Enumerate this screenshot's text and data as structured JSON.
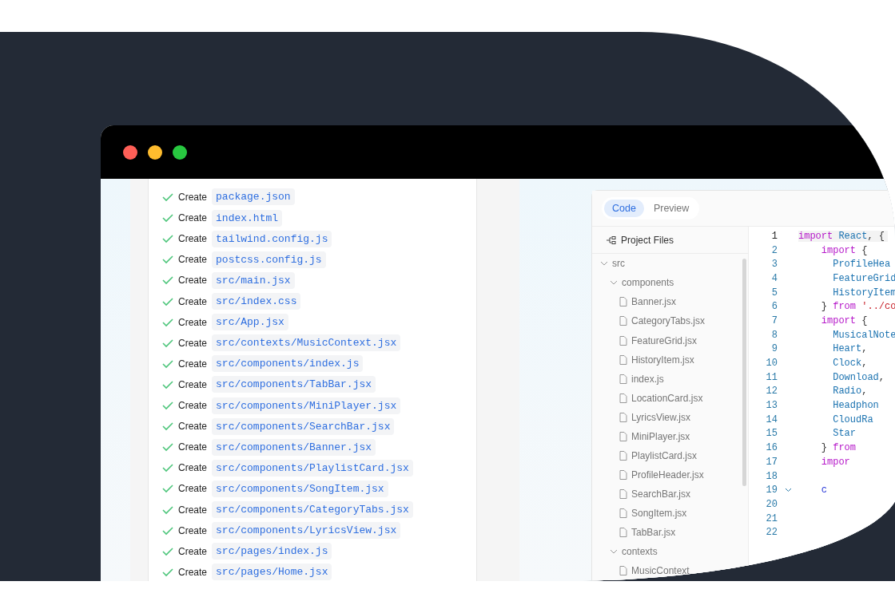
{
  "window": {
    "controls": [
      {
        "color": "#fe5f57"
      },
      {
        "color": "#febc2e"
      },
      {
        "color": "#28c840"
      }
    ]
  },
  "steps": [
    {
      "action": "Create",
      "file": "package.json",
      "done": true
    },
    {
      "action": "Create",
      "file": "index.html",
      "done": true
    },
    {
      "action": "Create",
      "file": "tailwind.config.js",
      "done": true
    },
    {
      "action": "Create",
      "file": "postcss.config.js",
      "done": true
    },
    {
      "action": "Create",
      "file": "src/main.jsx",
      "done": true
    },
    {
      "action": "Create",
      "file": "src/index.css",
      "done": true
    },
    {
      "action": "Create",
      "file": "src/App.jsx",
      "done": true
    },
    {
      "action": "Create",
      "file": "src/contexts/MusicContext.jsx",
      "done": true
    },
    {
      "action": "Create",
      "file": "src/components/index.js",
      "done": true
    },
    {
      "action": "Create",
      "file": "src/components/TabBar.jsx",
      "done": true
    },
    {
      "action": "Create",
      "file": "src/components/MiniPlayer.jsx",
      "done": true
    },
    {
      "action": "Create",
      "file": "src/components/SearchBar.jsx",
      "done": true
    },
    {
      "action": "Create",
      "file": "src/components/Banner.jsx",
      "done": true
    },
    {
      "action": "Create",
      "file": "src/components/PlaylistCard.jsx",
      "done": true
    },
    {
      "action": "Create",
      "file": "src/components/SongItem.jsx",
      "done": true
    },
    {
      "action": "Create",
      "file": "src/components/CategoryTabs.jsx",
      "done": true
    },
    {
      "action": "Create",
      "file": "src/components/LyricsView.jsx",
      "done": true
    },
    {
      "action": "Create",
      "file": "src/pages/index.js",
      "done": true
    },
    {
      "action": "Create",
      "file": "src/pages/Home.jsx",
      "done": true
    }
  ],
  "tabs": [
    {
      "label": "Code",
      "selected": true
    },
    {
      "label": "Preview",
      "selected": false
    }
  ],
  "project_files": {
    "title": "Project Files",
    "tree": [
      {
        "name": "src",
        "kind": "folder",
        "expanded": true,
        "children": [
          {
            "name": "components",
            "kind": "folder",
            "expanded": true,
            "children": [
              {
                "name": "Banner.jsx",
                "kind": "file"
              },
              {
                "name": "CategoryTabs.jsx",
                "kind": "file"
              },
              {
                "name": "FeatureGrid.jsx",
                "kind": "file"
              },
              {
                "name": "HistoryItem.jsx",
                "kind": "file"
              },
              {
                "name": "index.js",
                "kind": "file"
              },
              {
                "name": "LocationCard.jsx",
                "kind": "file"
              },
              {
                "name": "LyricsView.jsx",
                "kind": "file"
              },
              {
                "name": "MiniPlayer.jsx",
                "kind": "file"
              },
              {
                "name": "PlaylistCard.jsx",
                "kind": "file"
              },
              {
                "name": "ProfileHeader.jsx",
                "kind": "file"
              },
              {
                "name": "SearchBar.jsx",
                "kind": "file"
              },
              {
                "name": "SongItem.jsx",
                "kind": "file"
              },
              {
                "name": "TabBar.jsx",
                "kind": "file"
              }
            ]
          },
          {
            "name": "contexts",
            "kind": "folder",
            "expanded": true,
            "children": [
              {
                "name": "MusicContext",
                "kind": "file"
              }
            ]
          }
        ]
      }
    ]
  },
  "code": [
    {
      "number": "1",
      "current": true,
      "tokens": [
        {
          "kind": "keyword",
          "text": "import"
        },
        {
          "kind": "name",
          "text": " React"
        },
        {
          "kind": "plain",
          "text": ", {"
        }
      ]
    },
    {
      "number": "2",
      "tokens": [
        {
          "kind": "keyword",
          "text": "    import"
        },
        {
          "kind": "plain",
          "text": " {"
        }
      ]
    },
    {
      "number": "3",
      "tokens": [
        {
          "kind": "name",
          "text": "      ProfileHea"
        }
      ]
    },
    {
      "number": "4",
      "tokens": [
        {
          "kind": "name",
          "text": "      FeatureGrid"
        }
      ]
    },
    {
      "number": "5",
      "tokens": [
        {
          "kind": "name",
          "text": "      HistoryItem"
        }
      ]
    },
    {
      "number": "6",
      "tokens": [
        {
          "kind": "plain",
          "text": "    } "
        },
        {
          "kind": "keyword",
          "text": "from"
        },
        {
          "kind": "string",
          "text": " '../co"
        }
      ]
    },
    {
      "number": "7",
      "tokens": [
        {
          "kind": "keyword",
          "text": "    import"
        },
        {
          "kind": "plain",
          "text": " {"
        }
      ]
    },
    {
      "number": "8",
      "tokens": [
        {
          "kind": "name",
          "text": "      MusicalNote"
        }
      ]
    },
    {
      "number": "9",
      "tokens": [
        {
          "kind": "name",
          "text": "      Heart"
        },
        {
          "kind": "plain",
          "text": ","
        }
      ]
    },
    {
      "number": "10",
      "tokens": [
        {
          "kind": "name",
          "text": "      Clock"
        },
        {
          "kind": "plain",
          "text": ","
        }
      ]
    },
    {
      "number": "11",
      "tokens": [
        {
          "kind": "name",
          "text": "      Download"
        },
        {
          "kind": "plain",
          "text": ","
        }
      ]
    },
    {
      "number": "12",
      "tokens": [
        {
          "kind": "name",
          "text": "      Radio"
        },
        {
          "kind": "plain",
          "text": ","
        }
      ]
    },
    {
      "number": "13",
      "tokens": [
        {
          "kind": "name",
          "text": "      Headphon"
        }
      ]
    },
    {
      "number": "14",
      "tokens": [
        {
          "kind": "name",
          "text": "      CloudRa"
        }
      ]
    },
    {
      "number": "15",
      "tokens": [
        {
          "kind": "name",
          "text": "      Star"
        }
      ]
    },
    {
      "number": "16",
      "tokens": [
        {
          "kind": "plain",
          "text": "    } "
        },
        {
          "kind": "keyword",
          "text": "from"
        }
      ]
    },
    {
      "number": "17",
      "tokens": [
        {
          "kind": "keyword",
          "text": "    impor"
        }
      ]
    },
    {
      "number": "18"
    },
    {
      "number": "19",
      "foldable": true,
      "tokens": [
        {
          "kind": "decl",
          "text": "    c"
        }
      ]
    },
    {
      "number": "20"
    },
    {
      "number": "21"
    },
    {
      "number": "22"
    }
  ]
}
